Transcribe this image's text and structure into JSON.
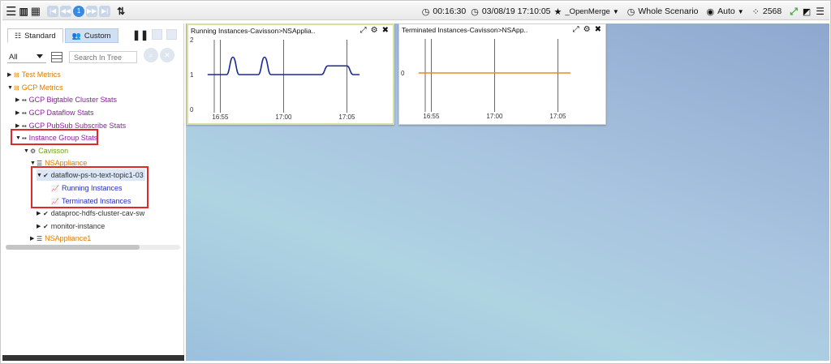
{
  "toolbar": {
    "menu_icon": "menu-icon",
    "pager": [
      "|◀",
      "◀◀",
      "1",
      "▶▶",
      "▶|"
    ],
    "elapsed": "00:16:30",
    "datetime": "03/08/19 17:10:05",
    "favorite": "_OpenMerge",
    "scenario": "Whole Scenario",
    "view_mode": "Auto",
    "refresh_count": "2568"
  },
  "sidebar": {
    "tab_standard": "Standard",
    "tab_custom": "Custom",
    "filter_value": "All",
    "search_placeholder": "Search In Tree",
    "tree": {
      "test_metrics": "Test Metrics",
      "gcp_metrics": "GCP Metrics",
      "gcp_bigtable": "GCP Bigtable Cluster Stats",
      "gcp_dataflow": "GCP Dataflow Stats",
      "gcp_pubsub": "GCP PubSub Subscribe Stats",
      "instance_group": "Instance Group Stats",
      "cavisson": "Cavisson",
      "nsappliance": "NSAppliance",
      "dataflow_topic": "dataflow-ps-to-text-topic1-03",
      "running_instances": "Running Instances",
      "terminated_instances": "Terminated Instances",
      "dataproc": "dataproc-hdfs-cluster-cav-sw",
      "monitor": "monitor-instance",
      "nsappliance1": "NSAppliance1"
    }
  },
  "panels": {
    "running": {
      "title": "Running Instances-Cavisson>NSApplia.."
    },
    "terminated": {
      "title": "Terminated Instances-Cavisson>NSApp.."
    }
  },
  "chart_data": [
    {
      "type": "line",
      "title": "Running Instances-Cavisson>NSApplia..",
      "x_ticks": [
        "16:55",
        "17:00",
        "17:05"
      ],
      "y_ticks": [
        "0",
        "1",
        "2"
      ],
      "ylim": [
        0,
        2
      ],
      "series": [
        {
          "color": "#1a2a9c",
          "x": [
            "16:54",
            "16:55",
            "16:55:30",
            "16:56",
            "16:56:30",
            "16:57",
            "16:58",
            "16:58:30",
            "16:59",
            "16:59:30",
            "17:00",
            "17:03",
            "17:03:30",
            "17:05",
            "17:05:30",
            "17:06"
          ],
          "values": [
            1,
            1,
            1,
            1.5,
            1,
            1,
            1,
            1.5,
            1,
            1,
            1,
            1,
            1.25,
            1.25,
            1,
            1
          ]
        }
      ]
    },
    {
      "type": "line",
      "title": "Terminated Instances-Cavisson>NSApp..",
      "x_ticks": [
        "16:55",
        "17:00",
        "17:05"
      ],
      "y_ticks": [
        "0"
      ],
      "series": [
        {
          "color": "#e88a2a",
          "x": [
            "16:54",
            "17:06"
          ],
          "values": [
            0,
            0
          ]
        }
      ]
    }
  ]
}
